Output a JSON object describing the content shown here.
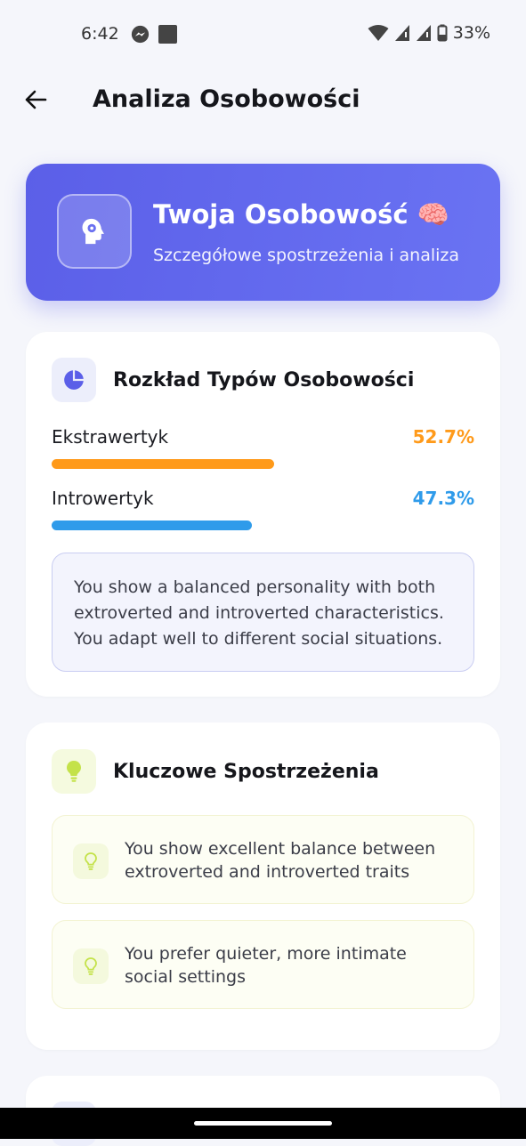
{
  "status_bar": {
    "time": "6:42",
    "battery": "33%",
    "icons": [
      "messenger-icon",
      "square-icon",
      "wifi-icon",
      "signal-icon",
      "signal-icon",
      "battery-icon"
    ]
  },
  "app_bar": {
    "title": "Analiza Osobowości",
    "back_icon": "arrow-left-icon"
  },
  "hero": {
    "title": "Twoja Osobowość 🧠",
    "subtitle": "Szczegółowe spostrzeżenia i analiza",
    "icon": "head-gear-icon",
    "gradient": [
      "#5b5fe8",
      "#6a73f3"
    ]
  },
  "distribution": {
    "title": "Rozkład Typów Osobowości",
    "icon": "pie-chart-icon",
    "traits": [
      {
        "label": "Ekstrawertyk",
        "value": "52.7%",
        "fraction": 0.527,
        "color": "#ff9a1a"
      },
      {
        "label": "Introwertyk",
        "value": "47.3%",
        "fraction": 0.473,
        "color": "#2f9bea"
      }
    ],
    "summary": "You show a balanced personality with both extroverted and introverted characteristics. You adapt well to different social situations."
  },
  "insights": {
    "title": "Kluczowe Spostrzeżenia",
    "icon": "lightbulb-icon",
    "items": [
      {
        "text": "You show excellent balance between extroverted and introverted traits",
        "icon": "lightbulb-outline-icon"
      },
      {
        "text": "You prefer quieter, more intimate social settings",
        "icon": "lightbulb-outline-icon"
      }
    ]
  },
  "colors": {
    "accent": "#5b5fe8",
    "background": "#f5f6fb",
    "extrovert": "#ff9a1a",
    "introvert": "#2f9bea"
  }
}
